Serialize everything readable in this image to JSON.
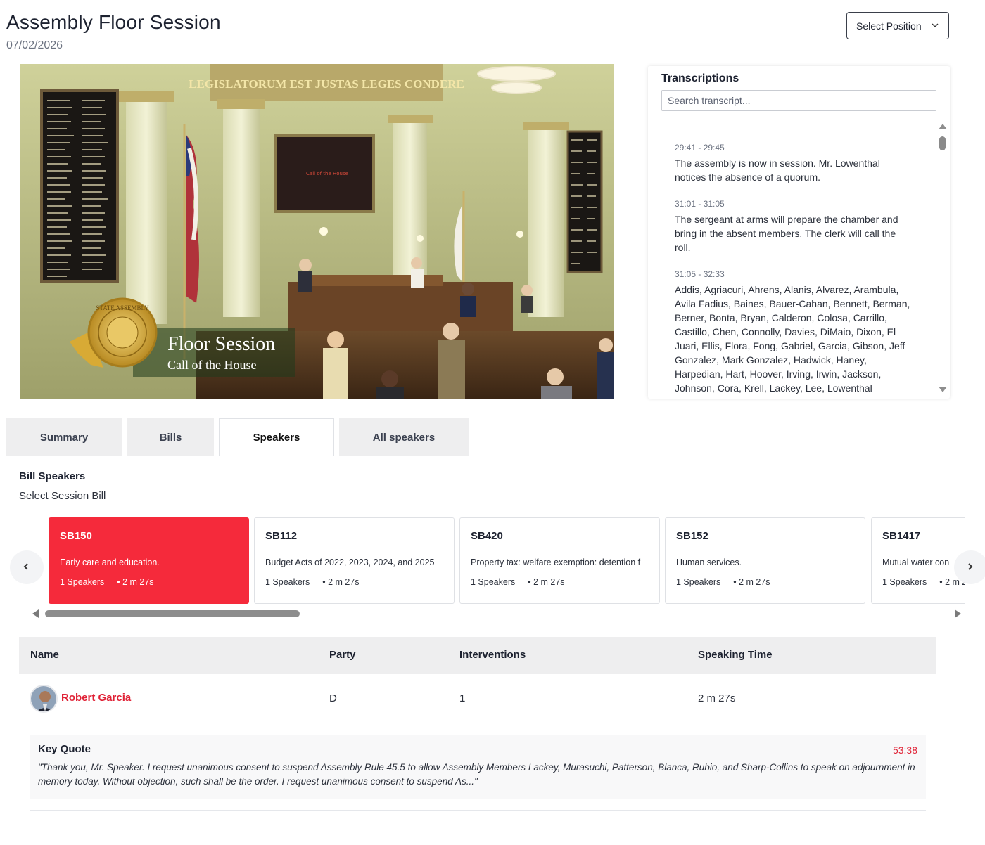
{
  "page": {
    "title": "Assembly Floor Session",
    "date": "07/02/2026"
  },
  "position_select": {
    "label": "Select Position"
  },
  "video": {
    "wall_inscription": "LEGISLATORUM EST JUSTAS LEGES CONDERE",
    "screen_text": "Call of the House",
    "overlay_title": "Floor Session",
    "overlay_subtitle": "Call of the House",
    "seal_text": "STATE ASSEMBLY"
  },
  "transcripts": {
    "title": "Transcriptions",
    "search_placeholder": "Search transcript...",
    "entries": [
      {
        "time": "29:41 - 29:45",
        "text": "The assembly is now in session. Mr. Lowenthal notices the absence of a quorum."
      },
      {
        "time": "31:01 - 31:05",
        "text": "The sergeant at arms will prepare the chamber and bring in the absent members. The clerk will call the roll."
      },
      {
        "time": "31:05 - 32:33",
        "text": "Addis, Agriacuri, Ahrens, Alanis, Alvarez, Arambula, Avila Fadius, Baines, Bauer-Cahan, Bennett, Berman, Berner, Bonta, Bryan, Calderon, Colosa, Carrillo, Castillo, Chen, Connolly, Davies, DiMaio, Dixon, El Juari, Ellis, Flora, Fong, Gabriel, Garcia, Gibson, Jeff Gonzalez, Mark Gonzalez, Hadwick, Haney, Harpedian, Hart, Hoover, Irving, Irwin, Jackson, Johnson, Cora, Krell, Lackey, Lee, Lowenthal"
      }
    ]
  },
  "tabs": [
    {
      "label": "Summary"
    },
    {
      "label": "Bills"
    },
    {
      "label": "Speakers"
    },
    {
      "label": "All speakers"
    }
  ],
  "bill_speakers": {
    "title": "Bill Speakers",
    "subtitle": "Select Session Bill",
    "bills": [
      {
        "id": "SB150",
        "desc": "Early care and education.",
        "speakers": "1 Speakers",
        "time": "2 m 27s",
        "active": true
      },
      {
        "id": "SB112",
        "desc": "Budget Acts of 2022, 2023, 2024, and 2025",
        "speakers": "1 Speakers",
        "time": "2 m 27s",
        "active": false
      },
      {
        "id": "SB420",
        "desc": "Property tax: welfare exemption: detention f",
        "speakers": "1 Speakers",
        "time": "2 m 27s",
        "active": false
      },
      {
        "id": "SB152",
        "desc": "Human services.",
        "speakers": "1 Speakers",
        "time": "2 m 27s",
        "active": false
      },
      {
        "id": "SB1417",
        "desc": "Mutual water con",
        "speakers": "1 Speakers",
        "time": "2 m 2",
        "active": false
      }
    ]
  },
  "speakers_table": {
    "headers": [
      "Name",
      "Party",
      "Interventions",
      "Speaking Time"
    ],
    "rows": [
      {
        "name": "Robert Garcia",
        "party": "D",
        "interventions": "1",
        "speaking_time": "2 m 27s"
      }
    ]
  },
  "key_quote": {
    "label": "Key Quote",
    "time": "53:38",
    "text": "\"Thank you, Mr. Speaker. I request unanimous consent to suspend Assembly Rule 45.5 to allow Assembly Members Lackey, Murasuchi, Patterson, Blanca, Rubio, and Sharp-Collins to speak on adjournment in memory today. Without objection, such shall be the order. I request unanimous consent to suspend As...\""
  },
  "colors": {
    "accent_red": "#f52a3b",
    "link_red": "#e02236"
  }
}
